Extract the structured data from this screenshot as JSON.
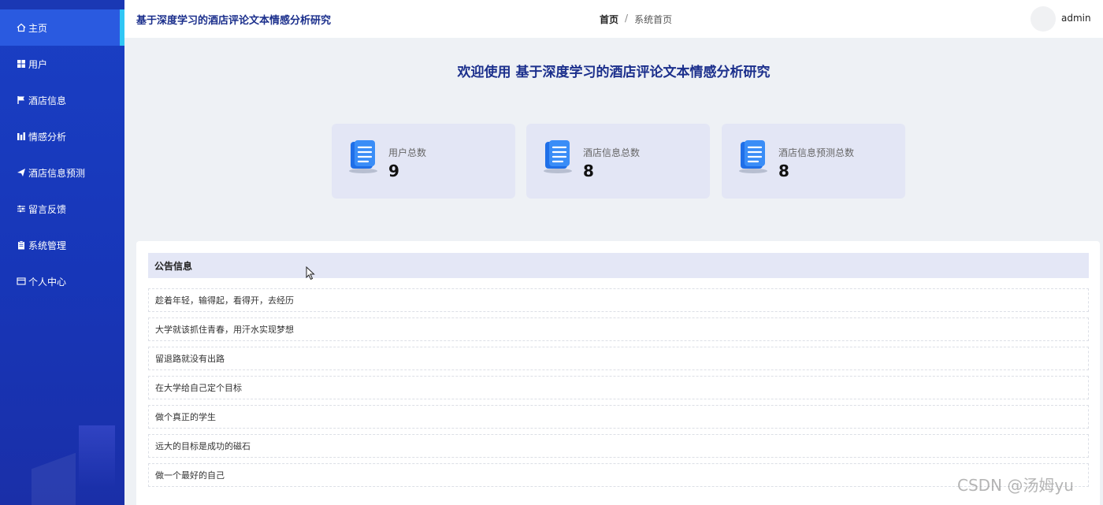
{
  "app_title": "基于深度学习的酒店评论文本情感分析研究",
  "sidebar": {
    "items": [
      {
        "label": "主页",
        "icon": "home-icon",
        "active": true
      },
      {
        "label": "用户",
        "icon": "grid-icon"
      },
      {
        "label": "酒店信息",
        "icon": "flag-icon"
      },
      {
        "label": "情感分析",
        "icon": "chart-icon"
      },
      {
        "label": "酒店信息预测",
        "icon": "send-icon"
      },
      {
        "label": "留言反馈",
        "icon": "sliders-icon"
      },
      {
        "label": "系统管理",
        "icon": "clipboard-icon"
      },
      {
        "label": "个人中心",
        "icon": "card-icon"
      }
    ]
  },
  "breadcrumb": {
    "home": "首页",
    "separator": "/",
    "current": "系统首页"
  },
  "user": {
    "name": "admin"
  },
  "welcome": "欢迎使用 基于深度学习的酒店评论文本情感分析研究",
  "stats": [
    {
      "label": "用户总数",
      "value": "9",
      "icon": "document-icon"
    },
    {
      "label": "酒店信息总数",
      "value": "8",
      "icon": "document-icon"
    },
    {
      "label": "酒店信息预测总数",
      "value": "8",
      "icon": "document-icon"
    }
  ],
  "notices": {
    "title": "公告信息",
    "items": [
      "趁着年轻，输得起，看得开，去经历",
      "大学就该抓住青春，用汗水实现梦想",
      "留退路就没有出路",
      "在大学给自己定个目标",
      "做个真正的学生",
      "远大的目标是成功的磁石",
      "做一个最好的自己"
    ]
  },
  "watermark": "CSDN @汤姆yu",
  "colors": {
    "sidebar": "#1a3fc4",
    "active": "#2a5ae0",
    "accent": "#30c6f5",
    "title": "#1b2f8c",
    "card": "#e3e6f5"
  }
}
